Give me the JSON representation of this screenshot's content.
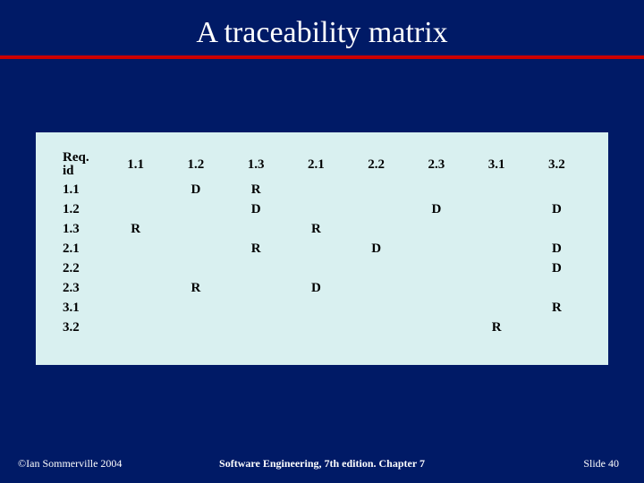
{
  "title": "A traceability matrix",
  "chart_data": {
    "type": "table",
    "row_header_label": [
      "Req.",
      "id"
    ],
    "columns": [
      "1.1",
      "1.2",
      "1.3",
      "2.1",
      "2.2",
      "2.3",
      "3.1",
      "3.2"
    ],
    "rows": [
      {
        "id": "1.1",
        "cells": [
          "",
          "D",
          "R",
          "",
          "",
          "",
          "",
          ""
        ]
      },
      {
        "id": "1.2",
        "cells": [
          "",
          "",
          "D",
          "",
          "",
          "D",
          "",
          "D"
        ]
      },
      {
        "id": "1.3",
        "cells": [
          "R",
          "",
          "",
          "R",
          "",
          "",
          "",
          ""
        ]
      },
      {
        "id": "2.1",
        "cells": [
          "",
          "",
          "R",
          "",
          "D",
          "",
          "",
          "D"
        ]
      },
      {
        "id": "2.2",
        "cells": [
          "",
          "",
          "",
          "",
          "",
          "",
          "",
          "D"
        ]
      },
      {
        "id": "2.3",
        "cells": [
          "",
          "R",
          "",
          "D",
          "",
          "",
          "",
          ""
        ]
      },
      {
        "id": "3.1",
        "cells": [
          "",
          "",
          "",
          "",
          "",
          "",
          "",
          "R"
        ]
      },
      {
        "id": "3.2",
        "cells": [
          "",
          "",
          "",
          "",
          "",
          "",
          "R",
          ""
        ]
      }
    ]
  },
  "footer": {
    "left": "©Ian Sommerville 2004",
    "center": "Software Engineering, 7th edition. Chapter 7",
    "right_prefix": "Slide ",
    "right_num": "40"
  }
}
